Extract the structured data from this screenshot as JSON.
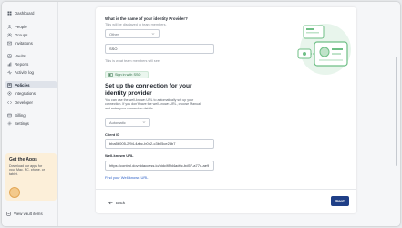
{
  "sidebar": {
    "items": [
      {
        "label": "Dashboard",
        "icon": "dashboard-icon"
      },
      {
        "label": "People",
        "icon": "people-icon"
      },
      {
        "label": "Groups",
        "icon": "groups-icon"
      },
      {
        "label": "Invitations",
        "icon": "invitations-icon"
      },
      {
        "label": "Vaults",
        "icon": "vaults-icon"
      },
      {
        "label": "Reports",
        "icon": "reports-icon"
      },
      {
        "label": "Activity log",
        "icon": "activity-log-icon"
      },
      {
        "label": "Policies",
        "icon": "policies-icon",
        "active": true
      },
      {
        "label": "Integrations",
        "icon": "integrations-icon"
      },
      {
        "label": "Developer",
        "icon": "developer-icon"
      },
      {
        "label": "Billing",
        "icon": "billing-icon"
      },
      {
        "label": "Settings",
        "icon": "settings-icon"
      }
    ],
    "promo": {
      "title": "Get the Apps",
      "text": "Download our apps for your Mac, PC, phone, or tablet."
    },
    "vault_link": "View vault items"
  },
  "form": {
    "provider_question": "What is the name of your identity Provider?",
    "provider_hint": "This will be displayed to team members.",
    "provider_select": "Other",
    "provider_name_value": "SSO",
    "provider_preview_hint": "This is what team members will see:",
    "sso_button_label": "Sign in with SSO",
    "section_title": "Set up the connection for your identity provider",
    "section_desc": "You can use the well-known URL to automatically set up your connection. If you don't have the well-known URL, choose Manual and enter your connection details.",
    "config_select": "Automatic",
    "client_id_label": "Client ID",
    "client_id_value": "bba5b005-2f94-4abc-b0b2-c3b05ce25b7",
    "wellknown_label": "Well-known URL",
    "wellknown_value": "https://control.doveidaccess.io/oidc/f8fd4ad0c-bd57-a77d-ae9",
    "find_link": "Find your Well-known URL",
    "back_label": "Back",
    "next_label": "Next"
  },
  "colors": {
    "accent": "#1f3f87",
    "link": "#2f62c8",
    "sso_green": "#2c6e43",
    "promo_bg": "#fcefd9"
  }
}
